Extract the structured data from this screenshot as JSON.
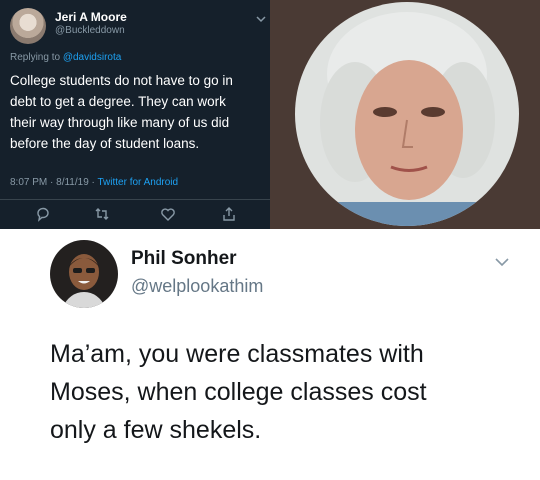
{
  "top_tweet": {
    "name": "Jeri A Moore",
    "handle": "@Buckleddown",
    "replying_prefix": "Replying to ",
    "replying_handle": "@davidsirota",
    "body": "College students do not have to go in\ndebt to get a degree. They can work\ntheir way through like many of us did\nbefore the day of student loans.",
    "timestamp": "8:07 PM · 8/11/19 · ",
    "client": "Twitter for Android",
    "actions": [
      "reply-icon",
      "retweet-icon",
      "like-icon",
      "share-icon"
    ],
    "colors": {
      "background": "#15202b",
      "accent": "#1da1f2",
      "muted": "#8899a6"
    }
  },
  "bottom_tweet": {
    "name": "Phil Sonher",
    "handle": "@welplookathim",
    "body": "Ma’am, you were classmates with\nMoses, when college classes cost\nonly a few shekels.",
    "colors": {
      "background": "#ffffff",
      "text": "#14171a",
      "muted": "#657786"
    }
  }
}
